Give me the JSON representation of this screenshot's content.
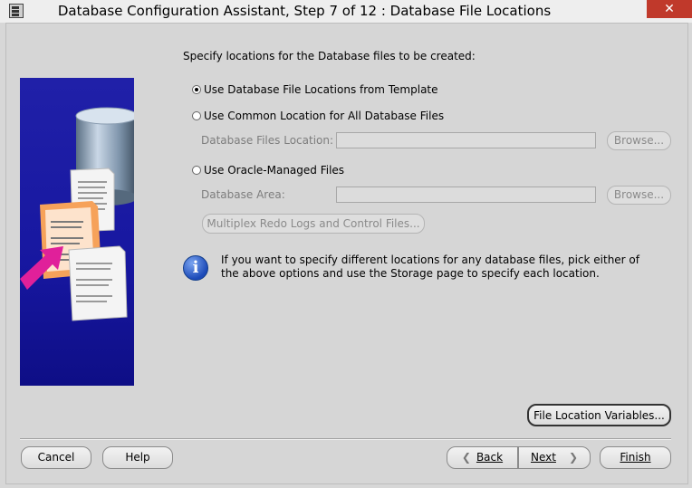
{
  "window": {
    "title": "Database Configuration Assistant, Step 7 of 12 : Database File Locations",
    "close_glyph": "✕"
  },
  "main": {
    "intro": "Specify locations for the Database files to be created:",
    "options": [
      {
        "label": "Use Database File Locations from Template",
        "selected": true
      },
      {
        "label": "Use Common Location for All Database Files",
        "selected": false
      },
      {
        "label": "Use Oracle-Managed Files",
        "selected": false
      }
    ],
    "common_location": {
      "label": "Database Files Location:",
      "value": "",
      "browse_label": "Browse..."
    },
    "managed": {
      "label": "Database Area:",
      "value": "",
      "browse_label": "Browse...",
      "multiplex_label": "Multiplex Redo Logs and Control Files..."
    },
    "info_text": "If you want to specify different locations for any database files, pick either of the above options and use the Storage page to specify each location.",
    "info_icon": "i"
  },
  "buttons": {
    "file_location_variables": "File Location Variables...",
    "cancel": "Cancel",
    "help": "Help",
    "back": "Back",
    "next": "Next",
    "finish": "Finish"
  },
  "colors": {
    "art_background": "#1a1aa2",
    "arrow": "#e0209a",
    "window_background": "#d6d6d6"
  }
}
